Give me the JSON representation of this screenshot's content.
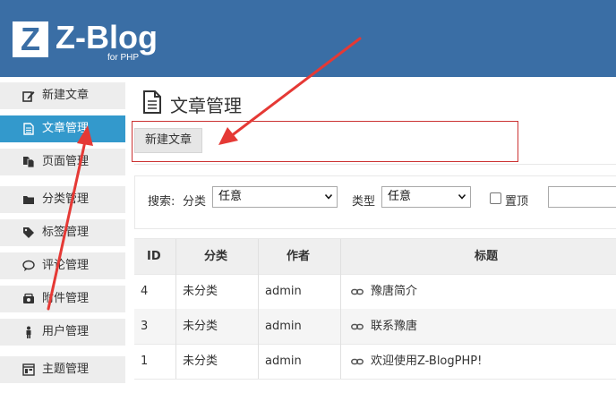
{
  "header": {
    "logo_letter": "Z",
    "logo_text": "Z-Blog",
    "logo_sub": "for PHP"
  },
  "sidebar": {
    "items": [
      {
        "label": "新建文章",
        "icon": "edit-icon"
      },
      {
        "label": "文章管理",
        "icon": "document-icon",
        "active": true
      },
      {
        "label": "页面管理",
        "icon": "pages-icon"
      },
      {
        "label": "分类管理",
        "icon": "folder-icon"
      },
      {
        "label": "标签管理",
        "icon": "tag-icon"
      },
      {
        "label": "评论管理",
        "icon": "comment-icon"
      },
      {
        "label": "附件管理",
        "icon": "attachment-icon"
      },
      {
        "label": "用户管理",
        "icon": "user-icon"
      },
      {
        "label": "主题管理",
        "icon": "theme-icon"
      }
    ]
  },
  "main": {
    "title": "文章管理",
    "new_button": "新建文章",
    "filter": {
      "search_label": "搜索:",
      "category_label": "分类",
      "category_value": "任意",
      "type_label": "类型",
      "type_value": "任意",
      "top_label": "置顶"
    },
    "table": {
      "headers": [
        "ID",
        "分类",
        "作者",
        "标题"
      ],
      "rows": [
        {
          "id": "4",
          "category": "未分类",
          "author": "admin",
          "title": "豫唐简介"
        },
        {
          "id": "3",
          "category": "未分类",
          "author": "admin",
          "title": "联系豫唐"
        },
        {
          "id": "1",
          "category": "未分类",
          "author": "admin",
          "title": "欢迎使用Z-BlogPHP!"
        }
      ]
    }
  },
  "colors": {
    "header_bg": "#3a6ea5",
    "active_item": "#3399cc",
    "annotation_red": "#e53935"
  }
}
